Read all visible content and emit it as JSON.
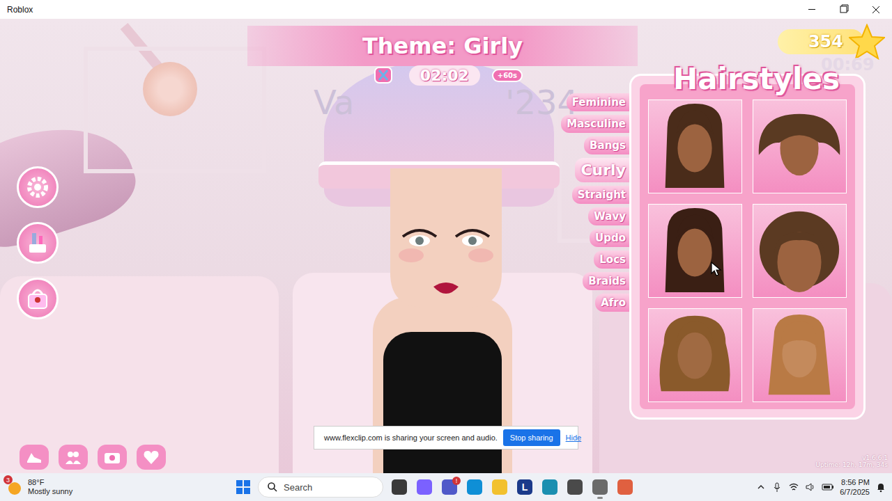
{
  "window": {
    "title": "Roblox"
  },
  "game": {
    "theme": "Theme: Girly",
    "timer": "02:02",
    "bonus": "+60s",
    "name_tag": [
      "Va",
      "'234"
    ],
    "coins": "354",
    "coin_timer": "00:69",
    "panel": {
      "title": "Hairstyles",
      "categories": [
        {
          "label": "Feminine",
          "selected": false
        },
        {
          "label": "Masculine",
          "selected": false
        },
        {
          "label": "Bangs",
          "selected": false
        },
        {
          "label": "Curly",
          "selected": true
        },
        {
          "label": "Straight",
          "selected": false
        },
        {
          "label": "Wavy",
          "selected": false
        },
        {
          "label": "Updo",
          "selected": false
        },
        {
          "label": "Locs",
          "selected": false
        },
        {
          "label": "Braids",
          "selected": false
        },
        {
          "label": "Afro",
          "selected": false
        }
      ],
      "items": [
        {
          "kind": "long",
          "color": "#4a2c1a",
          "hovered": false
        },
        {
          "kind": "puff",
          "color": "#5a3a22",
          "hovered": false
        },
        {
          "kind": "long",
          "color": "#3a1f14",
          "hovered": true
        },
        {
          "kind": "short",
          "color": "#5b3a22",
          "hovered": false
        },
        {
          "kind": "wavy",
          "color": "#8a5a2b",
          "hovered": false
        },
        {
          "kind": "bangs",
          "color": "#b97a45",
          "hovered": false
        }
      ]
    },
    "version": "v1.6.6.1",
    "uptime": "Uptime: 12h, 17m, 34s"
  },
  "share_bar": {
    "message": "www.flexclip.com is sharing your screen and audio.",
    "stop": "Stop sharing",
    "hide": "Hide"
  },
  "taskbar": {
    "weather": {
      "badge": "3",
      "temp": "88°F",
      "condition": "Mostly sunny"
    },
    "search": "Search",
    "apps": [
      {
        "glyph": "",
        "color": "#3a3a3a",
        "badge": "",
        "selected": false
      },
      {
        "glyph": "",
        "color": "#7b61ff",
        "badge": "",
        "selected": false
      },
      {
        "glyph": "",
        "color": "#5059c9",
        "badge": "!",
        "selected": false
      },
      {
        "glyph": "",
        "color": "#0f8fd6",
        "badge": "",
        "selected": false
      },
      {
        "glyph": "",
        "color": "#f2c12e",
        "badge": "",
        "selected": false
      },
      {
        "glyph": "L",
        "color": "#1b3a8a",
        "badge": "",
        "selected": false
      },
      {
        "glyph": "",
        "color": "#1a8fb0",
        "badge": "",
        "selected": false
      },
      {
        "glyph": "",
        "color": "#4a4a4a",
        "badge": "",
        "selected": false
      },
      {
        "glyph": "",
        "color": "#6a6a6a",
        "badge": "",
        "selected": true
      },
      {
        "glyph": "",
        "color": "#e06040",
        "badge": "",
        "selected": false
      }
    ],
    "time": "8:56 PM",
    "date": "6/7/2025"
  }
}
